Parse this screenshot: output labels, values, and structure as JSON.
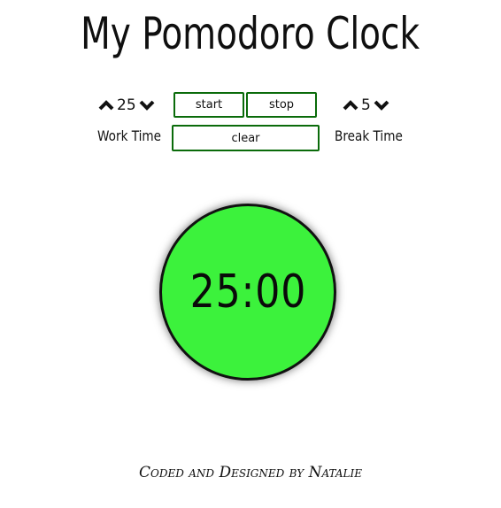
{
  "header": {
    "title": "My Pomodoro Clock"
  },
  "work": {
    "value": "25",
    "label": "Work Time",
    "increase_icon": "chevron-up-icon",
    "decrease_icon": "chevron-down-icon"
  },
  "break": {
    "value": "5",
    "label": "Break Time",
    "increase_icon": "chevron-up-icon",
    "decrease_icon": "chevron-down-icon"
  },
  "controls": {
    "start_label": "start",
    "stop_label": "stop",
    "clear_label": "clear"
  },
  "clock": {
    "time": "25:00"
  },
  "footer": {
    "credit": "Coded and Designed by Natalie"
  },
  "colors": {
    "clock_fill": "#3cf23c",
    "button_border": "#0a6b0a",
    "text": "#111111"
  }
}
